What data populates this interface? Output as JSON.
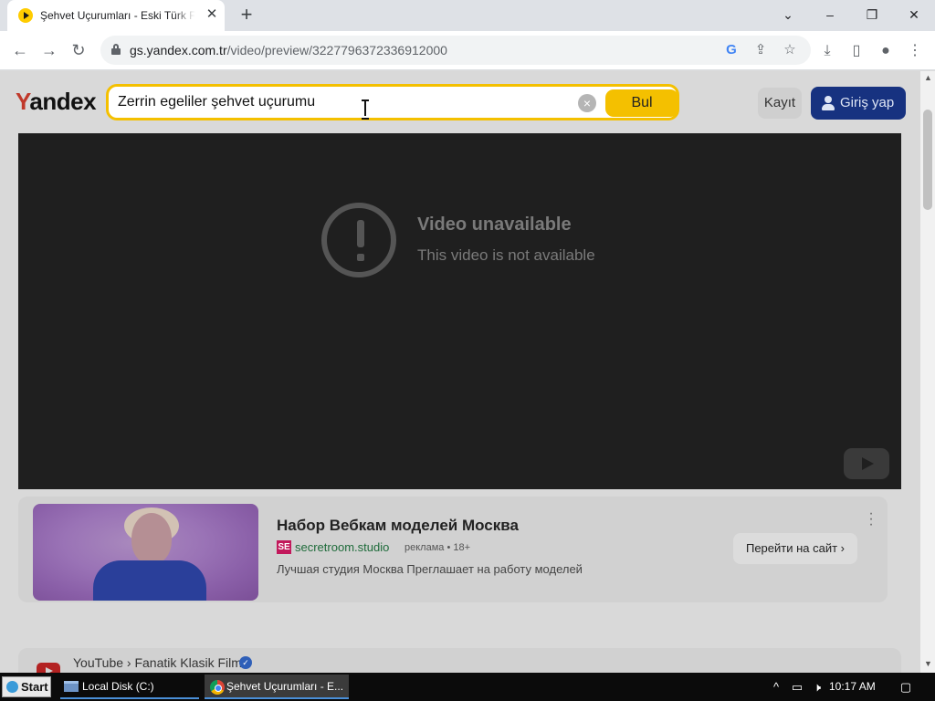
{
  "browser": {
    "tab": {
      "title": "Şehvet Uçurumları - Eski Türk Film",
      "close_label": "✕"
    },
    "new_tab_label": "+",
    "window_controls": {
      "dropdown": "⌄",
      "minimize": "–",
      "restore": "❐",
      "close": "✕"
    },
    "address": {
      "host": "gs.yandex.com.tr",
      "path": "/video/preview/3227796372336912000"
    }
  },
  "yandex": {
    "logo_first": "Y",
    "logo_rest": "andex",
    "search": {
      "value": "Zerrin egeliler şehvet uçurumu"
    },
    "find_button": "Bul",
    "register_button": "Kayıt",
    "login_button": "Giriş yap"
  },
  "player": {
    "error_title": "Video unavailable",
    "error_subtitle": "This video is not available"
  },
  "ad": {
    "title": "Набор Вебкам моделей Москва",
    "badge": "SE",
    "domain": "secretroom.studio",
    "meta": "реклама • 18+",
    "description": "Лучшая студия Москва Преглашает на работу моделей",
    "cta": "Перейти на сайт ›"
  },
  "result": {
    "source": "YouTube › Fanatik Klasik Film",
    "verified": "✓"
  },
  "taskbar": {
    "start": "Start",
    "tasks": [
      "Local Disk (C:)",
      "Şehvet Uçurumları - E..."
    ],
    "time": "10:17 AM"
  }
}
